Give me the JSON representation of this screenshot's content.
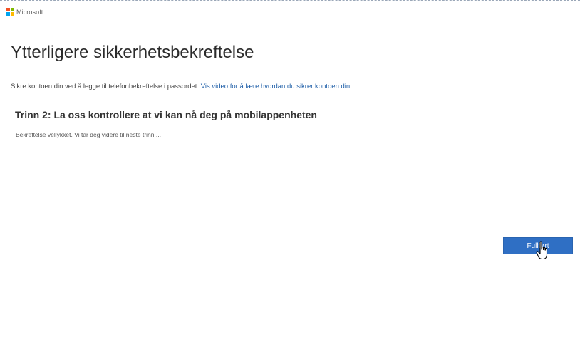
{
  "header": {
    "brand_name": "Microsoft",
    "logo_colors": [
      "#f25022",
      "#7fba00",
      "#00a4ef",
      "#ffb900"
    ]
  },
  "main": {
    "title": "Ytterligere sikkerhetsbekreftelse",
    "intro_text": "Sikre kontoen din ved å legge til telefonbekreftelse i passordet.",
    "intro_link": "Vis video for å lære hvordan du sikrer kontoen din",
    "step_heading": "Trinn 2: La oss kontrollere at vi kan nå deg på mobilappenheten",
    "status_text": "Bekreftelse vellykket. Vi tar deg videre til neste trinn ..."
  },
  "actions": {
    "finish_label": "Fullført"
  },
  "colors": {
    "accent": "#2f6fc4",
    "link": "#1f5fa8"
  }
}
